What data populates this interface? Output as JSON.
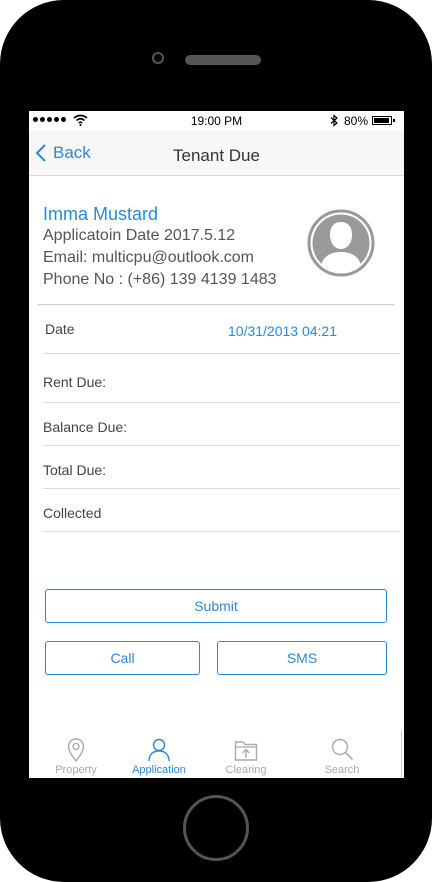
{
  "status_bar": {
    "time": "19:00 PM",
    "battery": "80%"
  },
  "nav": {
    "back_label": "Back",
    "title": "Tenant Due"
  },
  "profile": {
    "name": "Imma Mustard",
    "application_date": "Applicatoin Date 2017.5.12",
    "email": "Email: multicpu@outlook.com",
    "phone": "Phone No : (+86) 139 4139 1483"
  },
  "fields": [
    {
      "label": "Date",
      "value": "10/31/2013 04:21"
    },
    {
      "label": "Rent Due:",
      "value": ""
    },
    {
      "label": "Balance Due:",
      "value": ""
    },
    {
      "label": "Total Due:",
      "value": ""
    },
    {
      "label": "Collected",
      "value": ""
    }
  ],
  "buttons": {
    "submit": "Submit",
    "call": "Call",
    "sms": "SMS"
  },
  "tabs": [
    {
      "label": "Property",
      "icon": "location-pin-icon",
      "active": false
    },
    {
      "label": "Application",
      "icon": "person-icon",
      "active": true
    },
    {
      "label": "Clearing",
      "icon": "folder-upload-icon",
      "active": false
    },
    {
      "label": "Search",
      "icon": "search-icon",
      "active": false
    }
  ],
  "colors": {
    "accent": "#2b8ad6",
    "inactive": "#aaaaaa"
  }
}
